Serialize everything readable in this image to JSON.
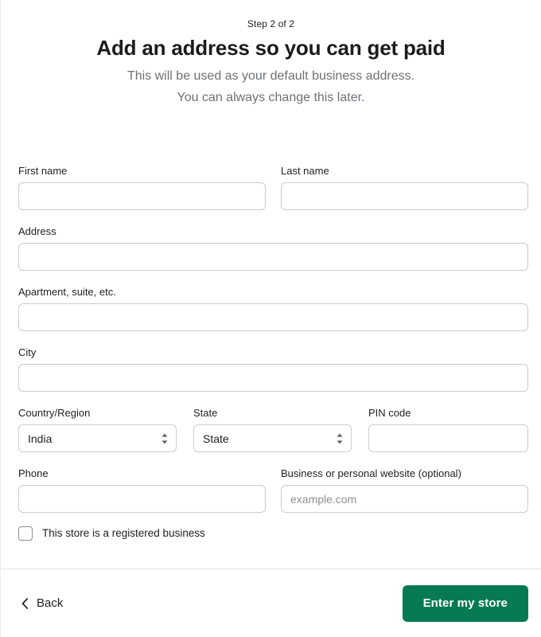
{
  "header": {
    "step_label": "Step 2 of 2",
    "title": "Add an address so you can get paid",
    "subtitle_line1": "This will be used as your default business address.",
    "subtitle_line2": "You can always change this later."
  },
  "form": {
    "first_name": {
      "label": "First name",
      "value": "",
      "placeholder": ""
    },
    "last_name": {
      "label": "Last name",
      "value": "",
      "placeholder": ""
    },
    "address": {
      "label": "Address",
      "value": "",
      "placeholder": ""
    },
    "apartment": {
      "label": "Apartment, suite, etc.",
      "value": "",
      "placeholder": ""
    },
    "city": {
      "label": "City",
      "value": "",
      "placeholder": ""
    },
    "country": {
      "label": "Country/Region",
      "selected": "India"
    },
    "state": {
      "label": "State",
      "selected": "State"
    },
    "pin_code": {
      "label": "PIN code",
      "value": "",
      "placeholder": ""
    },
    "phone": {
      "label": "Phone",
      "value": "",
      "placeholder": ""
    },
    "website": {
      "label": "Business or personal website (optional)",
      "value": "",
      "placeholder": "example.com"
    },
    "registered_business": {
      "label": "This store is a registered business",
      "checked": false
    }
  },
  "footer": {
    "back_label": "Back",
    "submit_label": "Enter my store"
  },
  "icons": {
    "country_stepper": "stepper-updown-icon",
    "state_stepper": "stepper-updown-icon",
    "back_chevron": "chevron-left-icon"
  },
  "colors": {
    "primary_green": "#067a53",
    "border_gray": "#c9cccf",
    "text_dark": "#202223",
    "text_muted": "#6d7175",
    "placeholder": "#8c9196"
  }
}
